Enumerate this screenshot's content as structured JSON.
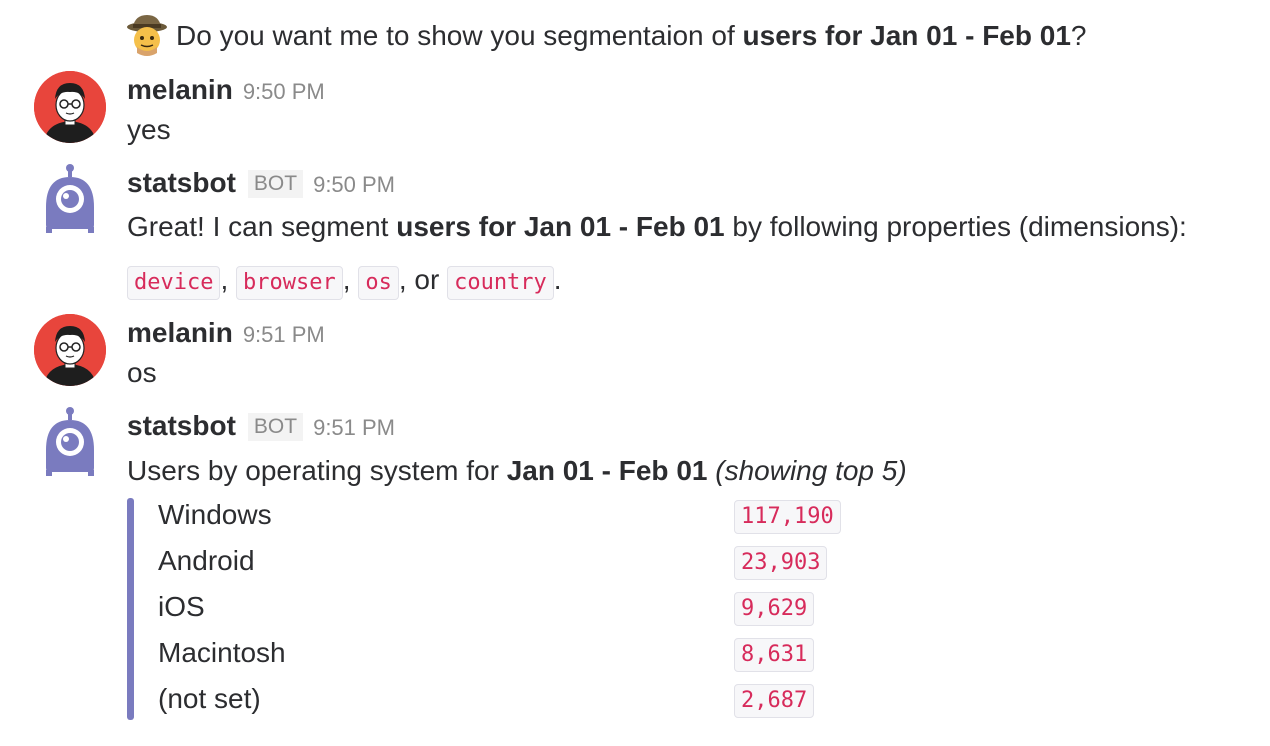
{
  "messages": {
    "intro": {
      "pre": "Do you want me to show you segmentaion of ",
      "bold": "users for Jan 01 - Feb 01",
      "post": "?"
    },
    "m1": {
      "name": "melanin",
      "time": "9:50 PM",
      "text": "yes"
    },
    "m2": {
      "name": "statsbot",
      "badge": "BOT",
      "time": "9:50 PM",
      "pre": "Great! I can segment ",
      "bold": "users for Jan 01 - Feb 01",
      "post": " by following properties (dimensions):",
      "dims": [
        "device",
        "browser",
        "os",
        "country"
      ],
      "comma": ",",
      "or": ", or",
      "period": "."
    },
    "m3": {
      "name": "melanin",
      "time": "9:51 PM",
      "text": "os"
    },
    "m4": {
      "name": "statsbot",
      "badge": "BOT",
      "time": "9:51 PM",
      "pre": "Users by operating system for ",
      "bold": "Jan 01 - Feb 01",
      "italic": "(showing top 5)"
    }
  },
  "table": {
    "rows": [
      {
        "label": "Windows",
        "value": "117,190"
      },
      {
        "label": "Android",
        "value": "23,903"
      },
      {
        "label": "iOS",
        "value": "9,629"
      },
      {
        "label": "Macintosh",
        "value": "8,631"
      },
      {
        "label": "(not set)",
        "value": "2,687"
      }
    ]
  },
  "colors": {
    "accent_bar": "#7a7bbf",
    "code_text": "#d72b5b",
    "avatar_person": "#e8453c",
    "bot_avatar": "#7a7bbf"
  }
}
